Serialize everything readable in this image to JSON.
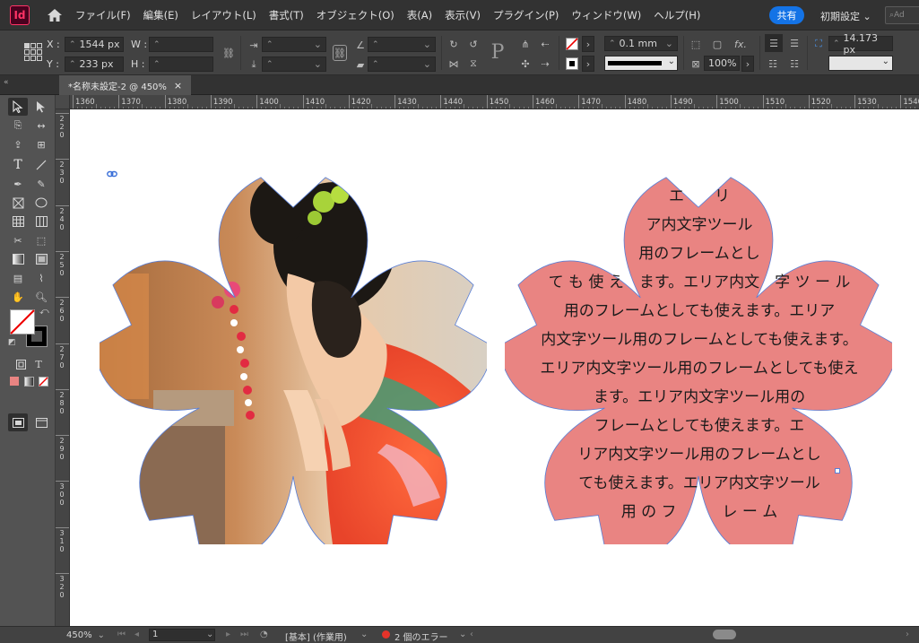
{
  "app": {
    "logo_text": "Id"
  },
  "menu": [
    "ファイル(F)",
    "編集(E)",
    "レイアウト(L)",
    "書式(T)",
    "オブジェクト(O)",
    "表(A)",
    "表示(V)",
    "プラグイン(P)",
    "ウィンドウ(W)",
    "ヘルプ(H)"
  ],
  "header": {
    "share_label": "共有",
    "workspace_label": "初期設定",
    "stock_placeholder": "Ad"
  },
  "control": {
    "x_label": "X :",
    "x_value": "1544 px",
    "y_label": "Y :",
    "y_value": "233 px",
    "w_label": "W :",
    "w_value": "",
    "h_label": "H :",
    "h_value": "",
    "stroke_weight": "0.1 mm",
    "opacity": "100%",
    "fx_label": "fx.",
    "gap_value": "14.173 px",
    "p_label": "P"
  },
  "tab": {
    "title": "*名称未設定-2 @ 450%"
  },
  "ruler": {
    "h_labels": [
      "1360",
      "1370",
      "1380",
      "1390",
      "1400",
      "1410",
      "1420",
      "1430",
      "1440",
      "1450",
      "1460",
      "1470",
      "1480",
      "1490",
      "1500",
      "1510",
      "1520",
      "1530",
      "1540"
    ],
    "v_labels": [
      "220",
      "230",
      "240",
      "250",
      "260",
      "270",
      "280",
      "290",
      "300",
      "310",
      "320"
    ]
  },
  "text_frame": {
    "lines": [
      "エ　　リ",
      "ア内文字ツール",
      "用のフレームとし",
      "て も 使 え　ます。エリア内文　字 ツ ー ル",
      "用のフレームとしても使えます。エリア",
      "内文字ツール用のフレームとしても使えます。",
      "エリア内文字ツール用のフレームとしても使え",
      "ます。エリア内文字ツール用の",
      "フレームとしても使えます。エ",
      "リア内文字ツール用のフレームとし",
      "ても使えます。エリア内文字ツール",
      "用 の フ　　　レ ー ム"
    ],
    "fill_color": "#e98482"
  },
  "status": {
    "zoom": "450%",
    "page": "1",
    "style": "[基本] (作業用)",
    "errors": "2 個のエラー"
  },
  "colors": {
    "accent": "#1473e6",
    "frame_outline": "#5a7fd6",
    "error": "#e6332a"
  }
}
